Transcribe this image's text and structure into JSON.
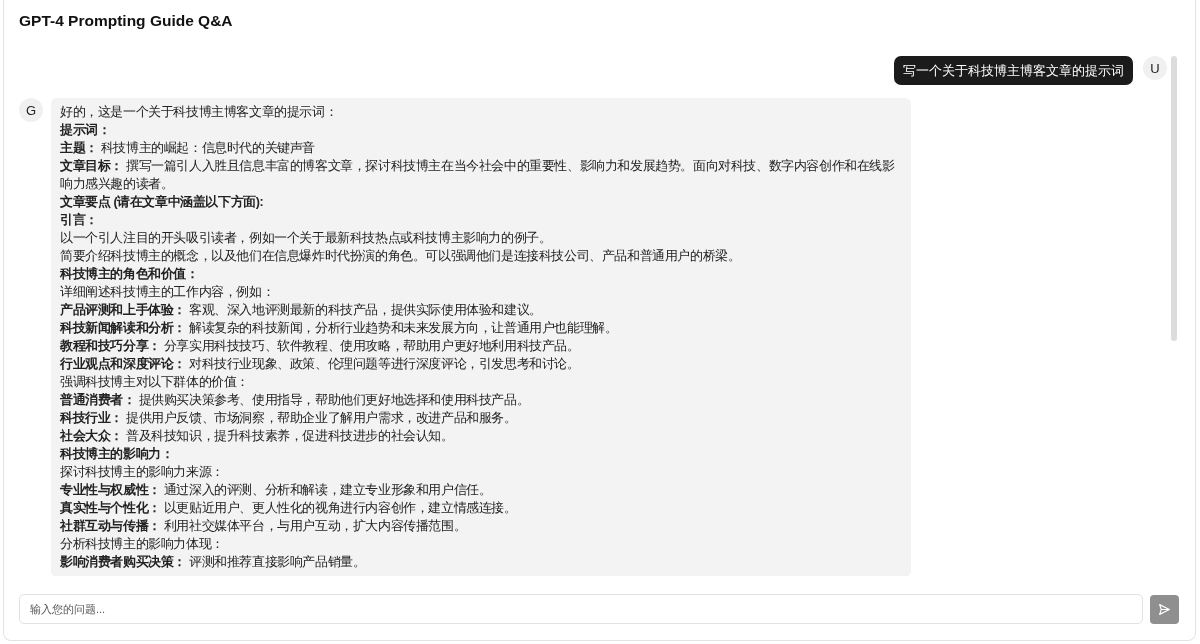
{
  "header": {
    "title": "GPT-4 Prompting Guide Q&A"
  },
  "messages": [
    {
      "kind": "user",
      "avatar": "U",
      "text": "写一个关于科技博主博客文章的提示词"
    },
    {
      "kind": "assistant",
      "avatar": "G",
      "lines": [
        {
          "kind": "plain",
          "text": "好的，这是一个关于科技博主博客文章的提示词："
        },
        {
          "kind": "heading",
          "text": "提示词："
        },
        {
          "kind": "plain",
          "text": "**主题：** 科技博主的崛起：信息时代的关键声音"
        },
        {
          "kind": "plain",
          "text": "**文章目标：** 撰写一篇引人入胜且信息丰富的博客文章，探讨科技博主在当今社会中的重要性、影响力和发展趋势。面向对科技、数字内容创作和在线影响力感兴趣的读者。"
        },
        {
          "kind": "heading",
          "text": "文章要点 (请在文章中涵盖以下方面):"
        },
        {
          "kind": "heading",
          "text": "引言："
        },
        {
          "kind": "plain",
          "text": "以一个引人注目的开头吸引读者，例如一个关于最新科技热点或科技博主影响力的例子。"
        },
        {
          "kind": "plain",
          "text": "简要介绍科技博主的概念，以及他们在信息爆炸时代扮演的角色。可以强调他们是连接科技公司、产品和普通用户的桥梁。"
        },
        {
          "kind": "heading",
          "text": "科技博主的角色和价值："
        },
        {
          "kind": "plain",
          "text": "详细阐述科技博主的工作内容，例如："
        },
        {
          "kind": "plain",
          "text": "**产品评测和上手体验：** 客观、深入地评测最新的科技产品，提供实际使用体验和建议。"
        },
        {
          "kind": "plain",
          "text": "**科技新闻解读和分析：** 解读复杂的科技新闻，分析行业趋势和未来发展方向，让普通用户也能理解。"
        },
        {
          "kind": "plain",
          "text": "**教程和技巧分享：** 分享实用科技技巧、软件教程、使用攻略，帮助用户更好地利用科技产品。"
        },
        {
          "kind": "plain",
          "text": "**行业观点和深度评论：** 对科技行业现象、政策、伦理问题等进行深度评论，引发思考和讨论。"
        },
        {
          "kind": "plain",
          "text": "强调科技博主对以下群体的价值："
        },
        {
          "kind": "plain",
          "text": "**普通消费者：** 提供购买决策参考、使用指导，帮助他们更好地选择和使用科技产品。"
        },
        {
          "kind": "plain",
          "text": "**科技行业：** 提供用户反馈、市场洞察，帮助企业了解用户需求，改进产品和服务。"
        },
        {
          "kind": "plain",
          "text": "**社会大众：** 普及科技知识，提升科技素养，促进科技进步的社会认知。"
        },
        {
          "kind": "heading",
          "text": "科技博主的影响力："
        },
        {
          "kind": "plain",
          "text": "探讨科技博主的影响力来源："
        },
        {
          "kind": "plain",
          "text": "**专业性与权威性：** 通过深入的评测、分析和解读，建立专业形象和用户信任。"
        },
        {
          "kind": "plain",
          "text": "**真实性与个性化：** 以更贴近用户、更人性化的视角进行内容创作，建立情感连接。"
        },
        {
          "kind": "plain",
          "text": "**社群互动与传播：** 利用社交媒体平台，与用户互动，扩大内容传播范围。"
        },
        {
          "kind": "plain",
          "text": "分析科技博主的影响力体现："
        },
        {
          "kind": "plain",
          "text": "**影响消费者购买决策：** 评测和推荐直接影响产品销量。"
        }
      ]
    }
  ],
  "composer": {
    "placeholder": "输入您的问题...",
    "send_disabled": true
  }
}
